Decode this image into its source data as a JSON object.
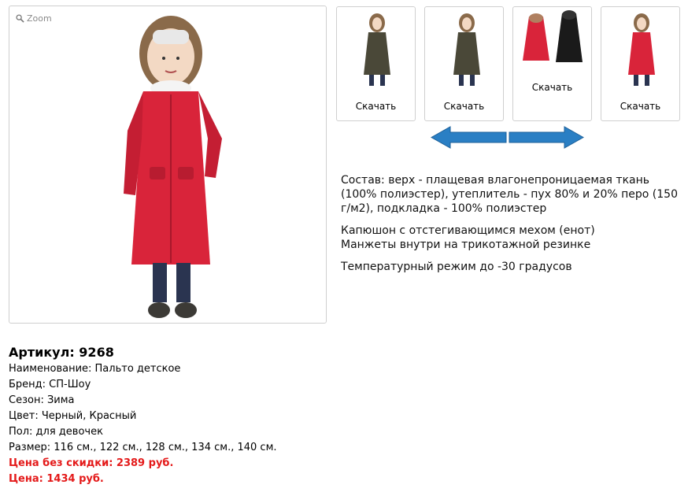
{
  "main_image": {
    "zoom_label": "Zoom"
  },
  "thumbnails": [
    {
      "download_label": "Скачать"
    },
    {
      "download_label": "Скачать"
    },
    {
      "download_label": "Скачать"
    },
    {
      "download_label": "Скачать"
    }
  ],
  "description": {
    "composition": "Состав: верх - плащевая влагонепроницаемая ткань (100% полиэстер), утеплитель - пух 80% и 20% перо (150 г/м2), подкладка - 100% полиэстер",
    "hood": "Капюшон с отстегивающимся мехом (енот)",
    "cuffs": "Манжеты внутри на трикотажной резинке",
    "temperature": "Температурный режим до -30 градусов"
  },
  "product": {
    "sku": "Артикул: 9268",
    "name": "Наименование: Пальто детское",
    "brand": "Бренд: СП-Шоу",
    "season": "Сезон: Зима",
    "color": "Цвет: Черный, Красный",
    "gender": "Пол: для девочек",
    "sizes": "Размер: 116 см., 122 см., 128 см., 134 см., 140 см.",
    "price_no_discount": "Цена без скидки: 2389 руб.",
    "price": "Цена: 1434 руб."
  },
  "colors": {
    "price_red": "#e41a1a",
    "arrow_blue": "#2a7fc4",
    "coat_red": "#d9243a"
  }
}
